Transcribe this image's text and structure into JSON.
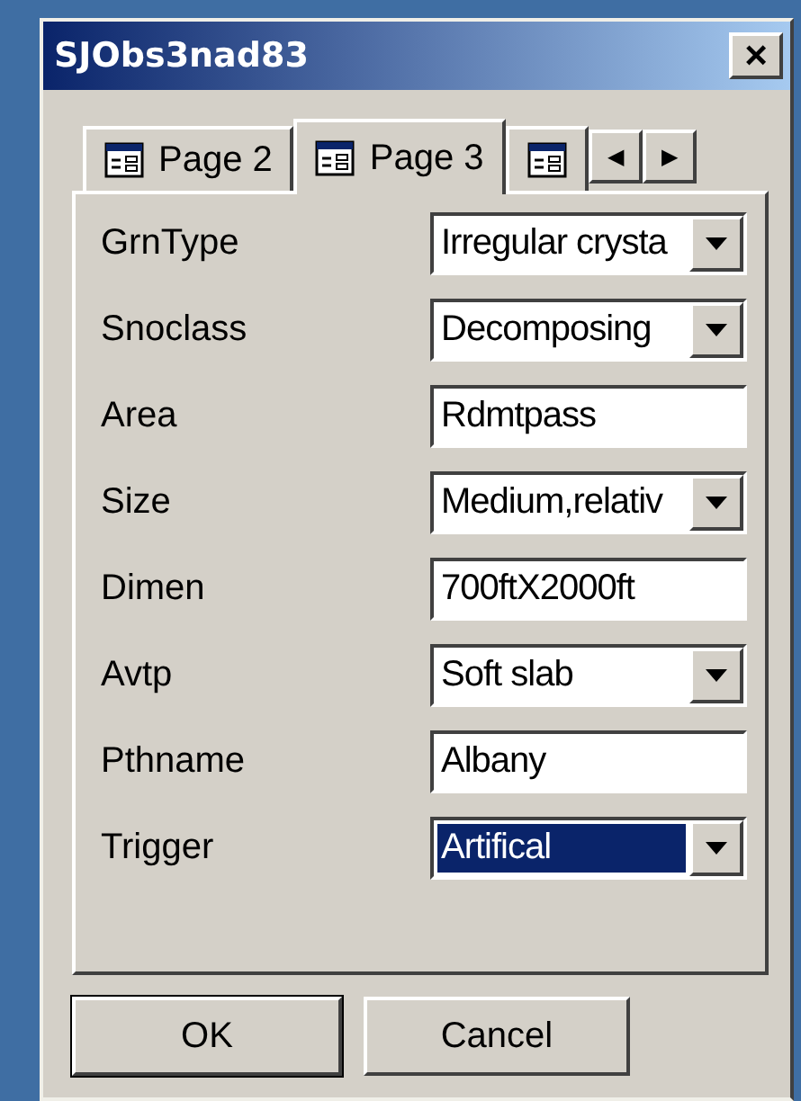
{
  "window": {
    "title": "SJObs3nad83",
    "close": "×"
  },
  "tabs": [
    {
      "label": "Page 2",
      "selected": false
    },
    {
      "label": "Page 3",
      "selected": true
    },
    {
      "selected": false
    }
  ],
  "tab_scroll": [
    "◀",
    "▶"
  ],
  "fields": [
    {
      "label": "GrnType",
      "kind": "dropdown",
      "value": "Irregular crysta",
      "highlighted": false
    },
    {
      "label": "Snoclass",
      "kind": "dropdown",
      "value": "Decomposing",
      "highlighted": false
    },
    {
      "label": "Area",
      "kind": "text",
      "value": "Rdmtpass"
    },
    {
      "label": "Size",
      "kind": "dropdown",
      "value": "Medium,relativ",
      "highlighted": false
    },
    {
      "label": "Dimen",
      "kind": "text",
      "value": "700ftX2000ft"
    },
    {
      "label": "Avtp",
      "kind": "dropdown",
      "value": "Soft slab",
      "highlighted": false
    },
    {
      "label": "Pthname",
      "kind": "text",
      "value": "Albany"
    },
    {
      "label": "Trigger",
      "kind": "dropdown",
      "value": "Artifical",
      "highlighted": true
    }
  ],
  "buttons": [
    {
      "label": "OK",
      "default": true
    },
    {
      "label": "Cancel",
      "default": false
    }
  ]
}
